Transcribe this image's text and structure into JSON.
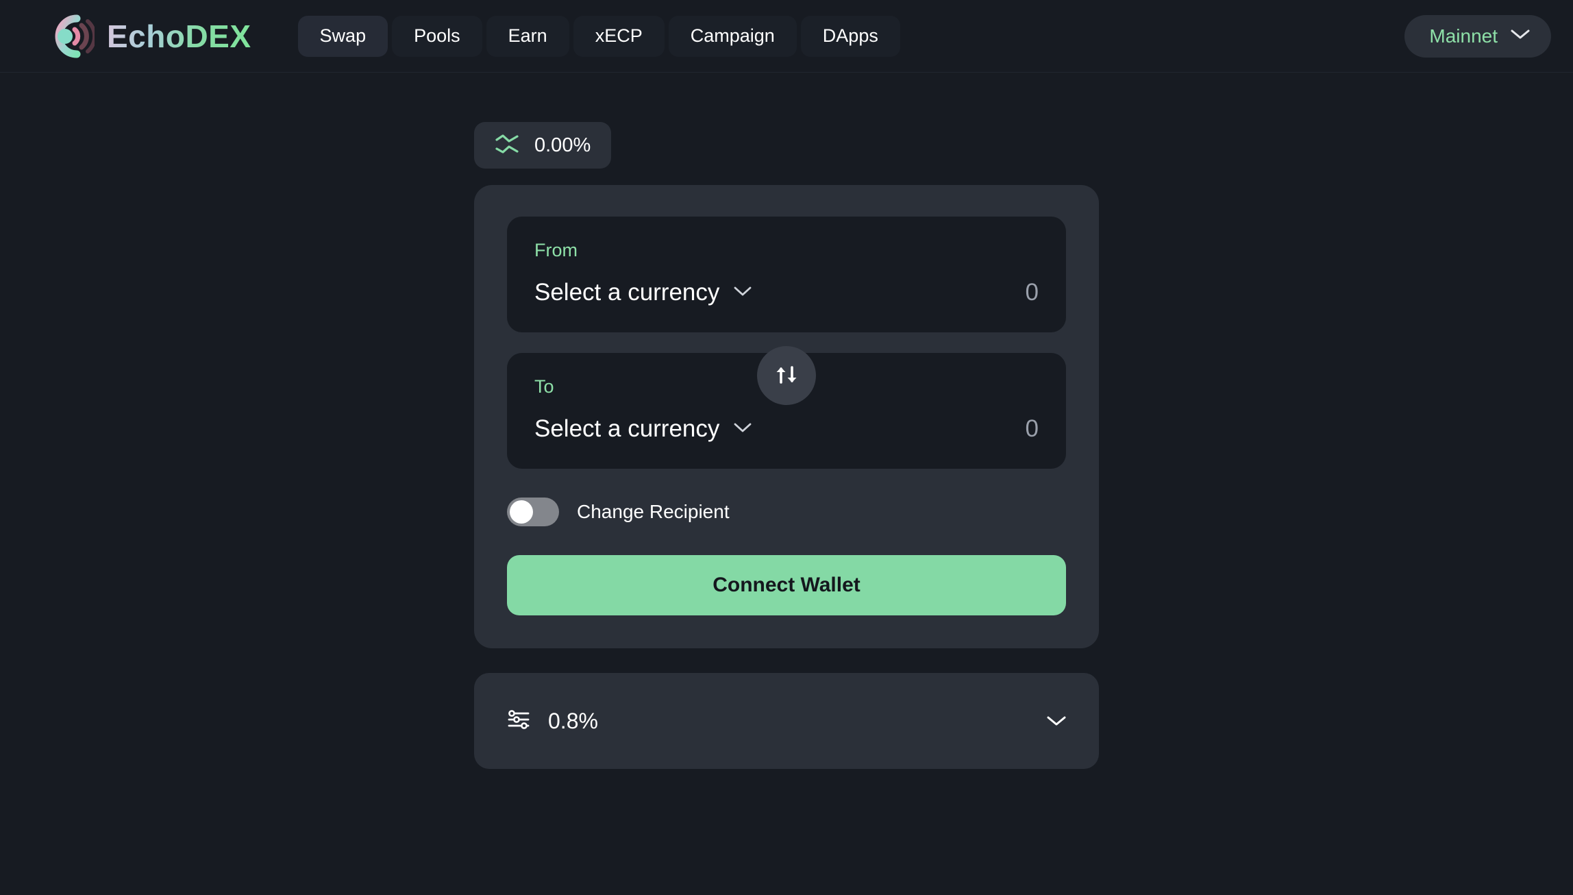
{
  "brand": {
    "name": "EchoDEX",
    "logo_icon": "echo-logo-icon"
  },
  "nav": {
    "items": [
      {
        "label": "Swap",
        "active": true
      },
      {
        "label": "Pools",
        "active": false
      },
      {
        "label": "Earn",
        "active": false
      },
      {
        "label": "xECP",
        "active": false
      },
      {
        "label": "Campaign",
        "active": false
      },
      {
        "label": "DApps",
        "active": false
      }
    ]
  },
  "network": {
    "label": "Mainnet",
    "chevron_icon": "chevron-down-icon"
  },
  "price_impact": {
    "icon": "chart-lines-icon",
    "value": "0.00%"
  },
  "swap": {
    "from": {
      "label": "From",
      "currency_placeholder": "Select a currency",
      "chevron_icon": "chevron-down-icon",
      "amount_value": "",
      "amount_placeholder": "0"
    },
    "to": {
      "label": "To",
      "currency_placeholder": "Select a currency",
      "chevron_icon": "chevron-down-icon",
      "amount_value": "",
      "amount_placeholder": "0"
    },
    "switch_icon": "swap-arrows-icon",
    "change_recipient": {
      "label": "Change Recipient",
      "enabled": false
    },
    "connect_label": "Connect Wallet"
  },
  "settings": {
    "icon": "sliders-icon",
    "slippage": "0.8%",
    "chevron_icon": "chevron-down-icon"
  },
  "colors": {
    "page_bg": "#171b22",
    "card_bg": "#2b3039",
    "field_bg": "#171b22",
    "accent_green": "#8ee0a8",
    "button_green": "#84d9a5",
    "text_primary": "#ffffff",
    "text_muted": "#9aa0ab"
  }
}
